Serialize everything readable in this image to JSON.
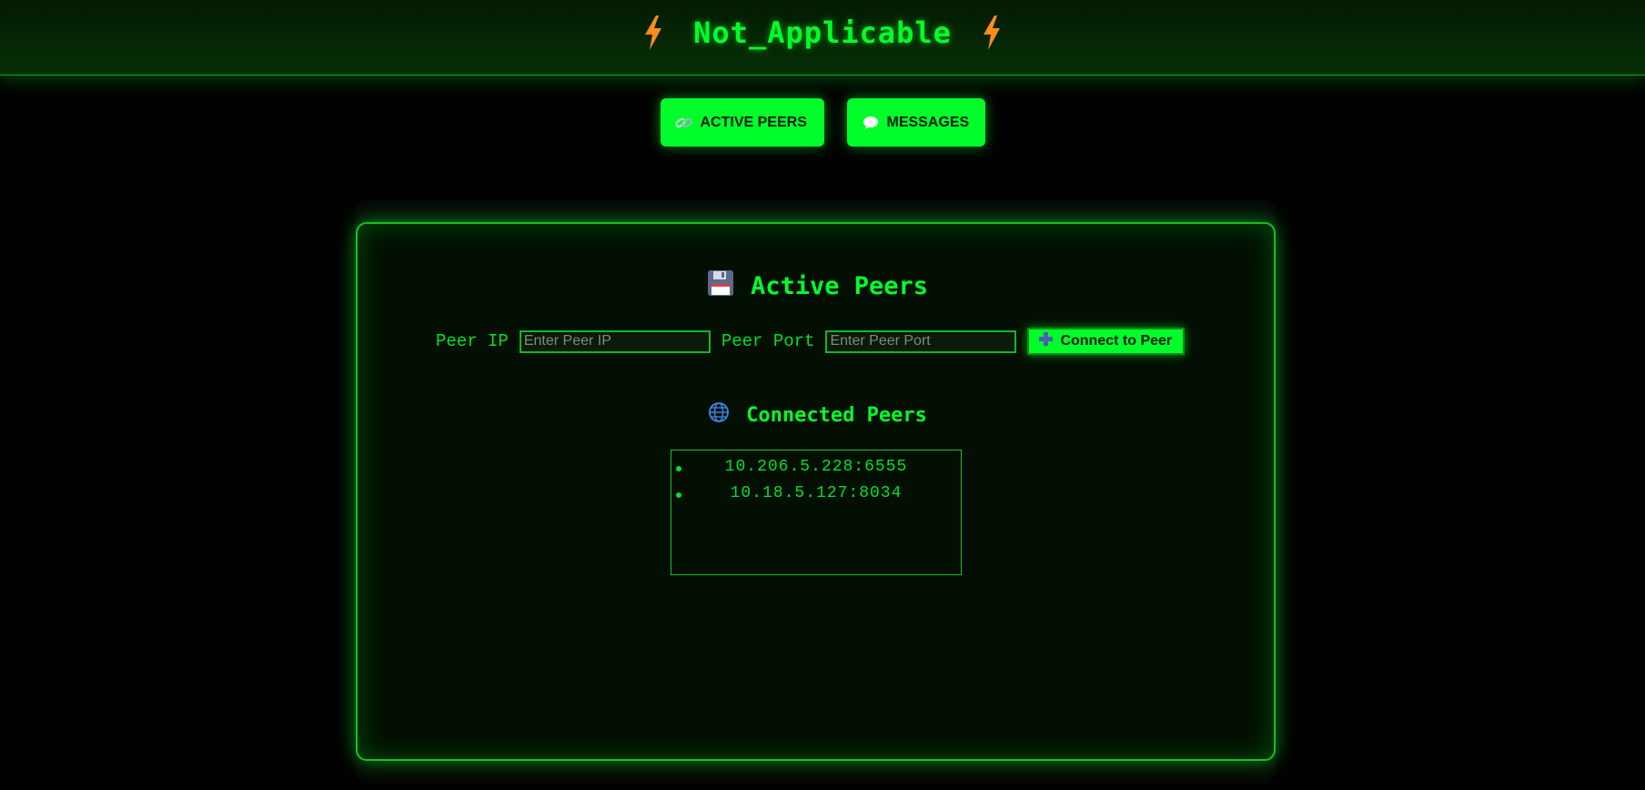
{
  "header": {
    "title": "Not_Applicable",
    "left_icon": "lightning-bolt",
    "right_icon": "lightning-bolt"
  },
  "nav": {
    "items": [
      {
        "label": "ACTIVE PEERS",
        "icon": "link-icon"
      },
      {
        "label": "MESSAGES",
        "icon": "speech-bubble-icon"
      }
    ]
  },
  "active_peers": {
    "title": "Active Peers",
    "title_icon": "floppy-disk",
    "peer_ip_label": "Peer IP",
    "peer_ip_placeholder": "Enter Peer IP",
    "peer_port_label": "Peer Port",
    "peer_port_placeholder": "Enter Peer Port",
    "connect_label": "Connect to Peer",
    "connect_icon": "plus"
  },
  "connected_peers": {
    "title": "Connected Peers",
    "title_icon": "globe",
    "items": [
      "10.206.5.228:6555",
      "10.18.5.127:8034"
    ]
  },
  "colors": {
    "accent": "#00ff2a",
    "background": "#000000",
    "panel": "#020f02",
    "bolt": "#ff8c1a"
  }
}
